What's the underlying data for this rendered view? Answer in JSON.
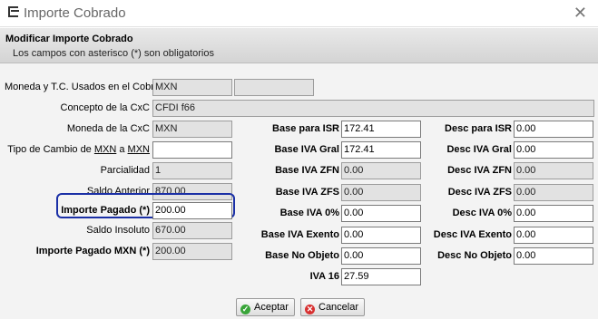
{
  "window": {
    "title": "Importe Cobrado",
    "close_glyph": "✕",
    "title_icon": "window-icon"
  },
  "header": {
    "title": "Modificar Importe Cobrado",
    "subtitle": "Los campos con asterisco (*) son obligatorios"
  },
  "left": {
    "moneda_tc_label": "Moneda y T.C. Usados en el Cobro",
    "moneda_tc_value": "MXN",
    "moneda_tc_extra": "",
    "concepto_label": "Concepto de la CxC",
    "concepto_value": "CFDI f66",
    "moneda_cxc_label": "Moneda de la CxC",
    "moneda_cxc_value": "MXN",
    "tipo_cambio_label_prefix": "Tipo de Cambio de ",
    "tipo_cambio_from": "MXN",
    "tipo_cambio_mid": " a ",
    "tipo_cambio_to": "MXN",
    "tipo_cambio_value": "",
    "parcialidad_label": "Parcialidad",
    "parcialidad_value": "1",
    "saldo_anterior_label": "Saldo Anterior",
    "saldo_anterior_value": "870.00",
    "importe_pagado_label": "Importe Pagado (*)",
    "importe_pagado_value": "200.00",
    "saldo_insoluto_label": "Saldo Insoluto",
    "saldo_insoluto_value": "670.00",
    "importe_mxn_label": "Importe Pagado MXN (*)",
    "importe_mxn_value": "200.00"
  },
  "middle": {
    "base_isr_label": "Base para ISR",
    "base_isr_value": "172.41",
    "base_iva_gral_label": "Base IVA Gral",
    "base_iva_gral_value": "172.41",
    "base_iva_zfn_label": "Base IVA ZFN",
    "base_iva_zfn_value": "0.00",
    "base_iva_zfs_label": "Base IVA ZFS",
    "base_iva_zfs_value": "0.00",
    "base_iva_0_label": "Base IVA 0%",
    "base_iva_0_value": "0.00",
    "base_iva_exento_label": "Base IVA Exento",
    "base_iva_exento_value": "0.00",
    "base_no_objeto_label": "Base No Objeto",
    "base_no_objeto_value": "0.00",
    "iva16_label": "IVA 16",
    "iva16_value": "27.59"
  },
  "right": {
    "desc_isr_label": "Desc para ISR",
    "desc_isr_value": "0.00",
    "desc_iva_gral_label": "Desc IVA Gral",
    "desc_iva_gral_value": "0.00",
    "desc_iva_zfn_label": "Desc IVA ZFN",
    "desc_iva_zfn_value": "0.00",
    "desc_iva_zfs_label": "Desc IVA ZFS",
    "desc_iva_zfs_value": "0.00",
    "desc_iva_0_label": "Desc IVA 0%",
    "desc_iva_0_value": "0.00",
    "desc_iva_exento_label": "Desc IVA Exento",
    "desc_iva_exento_value": "0.00",
    "desc_no_objeto_label": "Desc No Objeto",
    "desc_no_objeto_value": "0.00"
  },
  "buttons": {
    "accept": "Aceptar",
    "cancel": "Cancelar",
    "accept_icon": "check-icon",
    "cancel_icon": "x-circle-icon"
  },
  "colors": {
    "highlight_border": "#1a2fa6",
    "readonly_bg": "#e2e2e2",
    "accept_icon": "#39a539",
    "cancel_icon": "#d83131"
  }
}
